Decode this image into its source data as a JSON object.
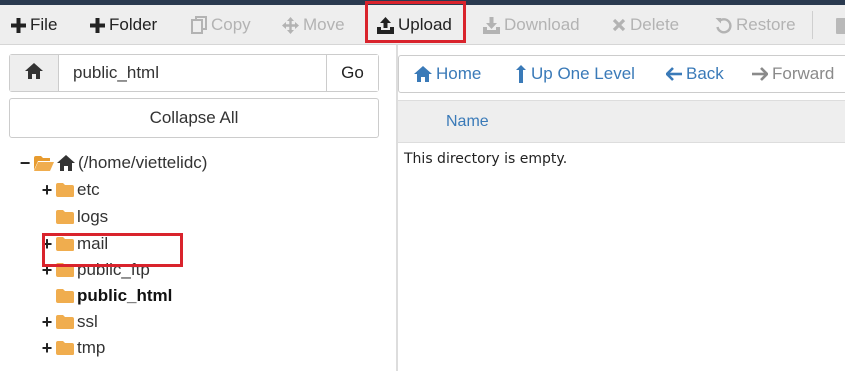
{
  "toolbar": {
    "file": "File",
    "folder": "Folder",
    "copy": "Copy",
    "move": "Move",
    "upload": "Upload",
    "download": "Download",
    "delete": "Delete",
    "restore": "Restore"
  },
  "path": {
    "value": "public_html",
    "go": "Go"
  },
  "collapse_all": "Collapse All",
  "tree": {
    "root": "(/home/viettelidc)",
    "items": [
      "etc",
      "logs",
      "mail",
      "public_ftp",
      "public_html",
      "ssl",
      "tmp"
    ]
  },
  "nav": {
    "home": "Home",
    "up": "Up One Level",
    "back": "Back",
    "forward": "Forward"
  },
  "table": {
    "name_col": "Name"
  },
  "empty_message": "This directory is empty.",
  "colors": {
    "accent": "#3a7ab8",
    "highlight": "#d9232c",
    "folder": "#f0ad4e",
    "toolbar_bg": "#eeeeee"
  }
}
